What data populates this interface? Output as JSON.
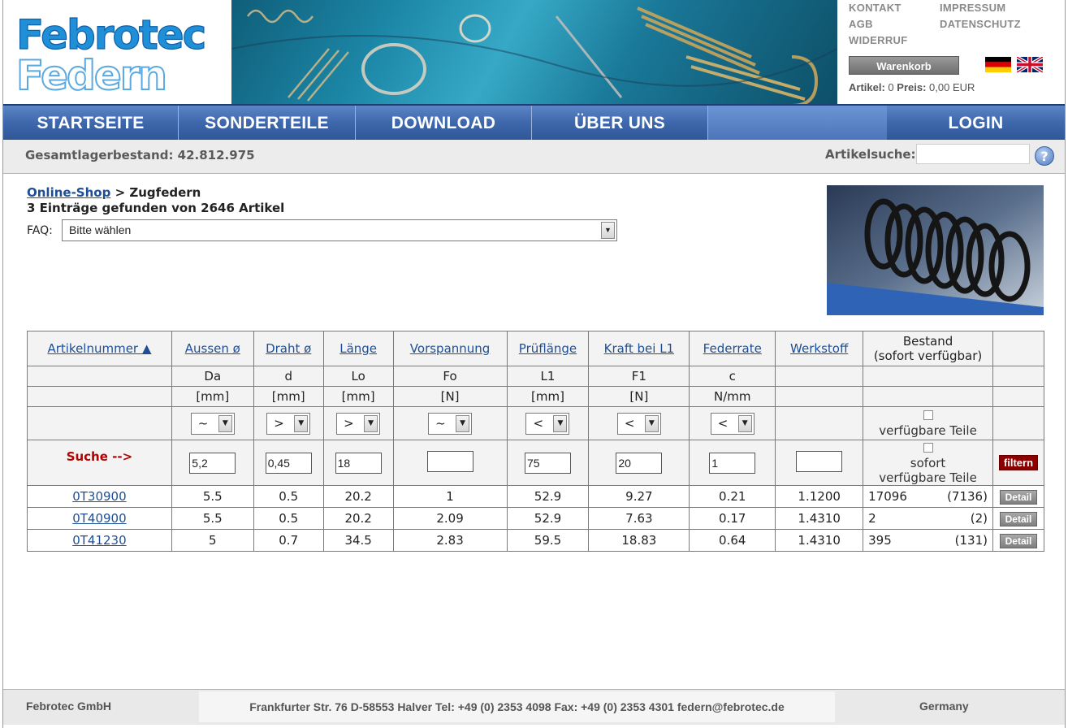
{
  "brand": {
    "logo_line1": "Febrotec",
    "logo_line2": "Federn"
  },
  "toplinks": [
    "KONTAKT",
    "IMPRESSUM",
    "AGB",
    "DATENSCHUTZ",
    "WIDERRUF"
  ],
  "cart": {
    "button_label": "Warenkorb",
    "artikel_label": "Artikel:",
    "artikel_value": "0",
    "preis_label": "Preis:",
    "preis_value": "0,00 EUR"
  },
  "languages": [
    "de-flag-icon",
    "uk-flag-icon"
  ],
  "nav": {
    "items": [
      "STARTSEITE",
      "SONDERTEILE",
      "DOWNLOAD",
      "ÜBER UNS"
    ],
    "login": "LOGIN"
  },
  "status": {
    "stock_text": "Gesamtlagerbestand: 42.812.975",
    "search_label": "Artikelsuche:",
    "search_value": "",
    "help_glyph": "?"
  },
  "breadcrumb": {
    "link": "Online-Shop",
    "separator": ">",
    "current": "Zugfedern"
  },
  "result_count": "3 Einträge gefunden von 2646 Artikel",
  "faq": {
    "label": "FAQ:",
    "selected": "Bitte wählen"
  },
  "table": {
    "headers": [
      "Artikelnummer ▲",
      "Aussen ø",
      "Draht ø",
      "Länge",
      "Vorspannung",
      "Prüflänge",
      "Kraft bei L1",
      "Federrate",
      "Werkstoff"
    ],
    "stock_header_1": "Bestand",
    "stock_header_2": "(sofort verfügbar)",
    "symbols": [
      "Da",
      "d",
      "Lo",
      "Fo",
      "L1",
      "F1",
      "c"
    ],
    "units": [
      "[mm]",
      "[mm]",
      "[mm]",
      "[N]",
      "[mm]",
      "[N]",
      "N/mm"
    ],
    "operators": [
      "~",
      ">",
      ">",
      "~",
      "<",
      "<",
      "<"
    ],
    "checkbox_available": "verfügbare Teile",
    "search_label": "Suche -->",
    "filter_values": [
      "5,2",
      "0,45",
      "18",
      "",
      "75",
      "20",
      "1",
      ""
    ],
    "checkbox_immediate_1": "sofort",
    "checkbox_immediate_2": "verfügbare Teile",
    "filter_button": "filtern",
    "detail_button": "Detail",
    "rows": [
      {
        "art": "0T30900",
        "da": "5.5",
        "d": "0.5",
        "lo": "20.2",
        "fo": "1",
        "l1": "52.9",
        "f1": "9.27",
        "c": "0.21",
        "ws": "1.1200",
        "stock": "17096",
        "avail": "(7136)"
      },
      {
        "art": "0T40900",
        "da": "5.5",
        "d": "0.5",
        "lo": "20.2",
        "fo": "2.09",
        "l1": "52.9",
        "f1": "7.63",
        "c": "0.17",
        "ws": "1.4310",
        "stock": "2",
        "avail": "(2)"
      },
      {
        "art": "0T41230",
        "da": "5",
        "d": "0.7",
        "lo": "34.5",
        "fo": "2.83",
        "l1": "59.5",
        "f1": "18.83",
        "c": "0.64",
        "ws": "1.4310",
        "stock": "395",
        "avail": "(131)"
      }
    ]
  },
  "footer": {
    "company": "Febrotec GmbH",
    "address": "Frankfurter Str. 76 D-58553 Halver Tel: +49 (0) 2353 4098 Fax: +49 (0) 2353 4301 federn@febrotec.de",
    "country": "Germany"
  },
  "colors": {
    "nav_blue": "#3e68ab",
    "link_blue": "#1e4f96",
    "logo_blue": "#1f8fd8",
    "filter_red": "#8c0000",
    "search_red": "#b40000"
  }
}
